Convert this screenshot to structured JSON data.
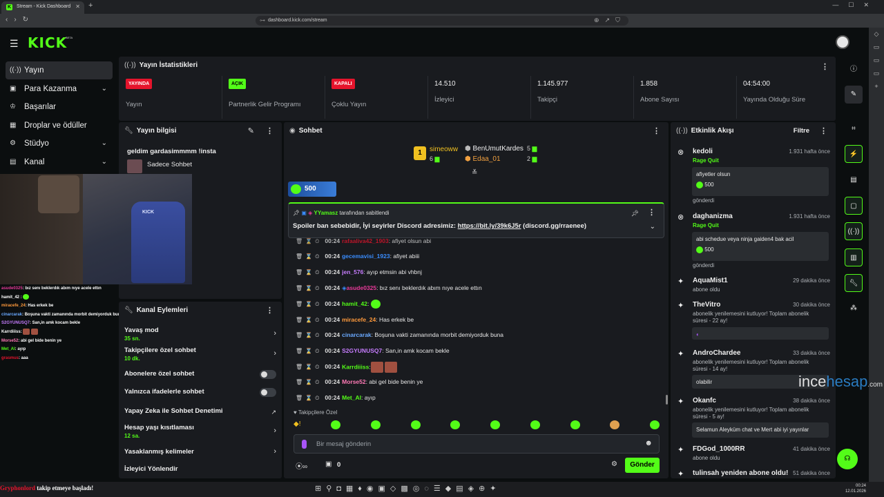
{
  "browser": {
    "tab_title": "Stream - Kick Dashboard",
    "url": "dashboard.kick.com/stream"
  },
  "brand": {
    "logo": "KICK",
    "beta": "BETA",
    "accent": "#53fc18"
  },
  "nav": [
    {
      "label": "Yayın",
      "icon": "broadcast-icon"
    },
    {
      "label": "Para Kazanma",
      "icon": "money-icon"
    },
    {
      "label": "Başarılar",
      "icon": "trophy-icon"
    },
    {
      "label": "Droplar ve ödüller",
      "icon": "gift-icon"
    },
    {
      "label": "Stüdyo",
      "icon": "studio-icon"
    },
    {
      "label": "Kanal",
      "icon": "channel-icon"
    }
  ],
  "stats": {
    "title": "Yayın İstatistikleri",
    "items": [
      {
        "badge": "YAYINDA",
        "label": "Yayın",
        "color": "#e5142c"
      },
      {
        "badge": "AÇIK",
        "label": "Partnerlik Gelir Programı",
        "color": "#53fc18"
      },
      {
        "badge": "KAPALI",
        "label": "Çoklu Yayın",
        "color": "#e5142c"
      },
      {
        "value": "14.510",
        "label": "İzleyici"
      },
      {
        "value": "1.145.977",
        "label": "Takipçi"
      },
      {
        "value": "1.858",
        "label": "Abone Sayısı"
      },
      {
        "value": "04:54:00",
        "label": "Yayında Olduğu Süre"
      }
    ]
  },
  "info": {
    "title": "Yayın bilgisi",
    "stream_title": "geldim gardasimmmm !insta",
    "category": "Sadece Sohbet"
  },
  "overlay_chat": [
    {
      "user": "asude0325",
      "msg": ": bız senı beklerdık abım nıye acele ettın",
      "color": "#e83a9a"
    },
    {
      "user": "hamit_42",
      "msg": " :",
      "color": "#f0f0f0"
    },
    {
      "user": "miracefe_24",
      "msg": ": Has erkek be",
      "color": "#ff9a3c"
    },
    {
      "user": "cinarcarak",
      "msg": ": Boşuna vakti zamanında morbit demiyorduk buna",
      "color": "#6aa9ff"
    },
    {
      "user": "S2GYUNUSQ7",
      "msg": ": San,in amk kocam bekle",
      "color": "#c77dff"
    },
    {
      "user": "Karrdiiiss",
      "msg": ":",
      "color": "#53fc18"
    },
    {
      "user": "Morse52",
      "msg": ": abi gel bide benin ye",
      "color": "#ff7ab6"
    },
    {
      "user": "Met_Al",
      "msg": ": ayıp",
      "color": "#53fc18"
    },
    {
      "user": "grasmus",
      "msg": ": aaa",
      "color": "#e5142c"
    }
  ],
  "actions": {
    "title": "Kanal Eylemleri",
    "items": [
      {
        "label": "Yavaş mod",
        "sub": "35 sn.",
        "type": "chev"
      },
      {
        "label": "Takipçilere özel sohbet",
        "sub": "10 dk.",
        "type": "chev"
      },
      {
        "label": "Abonelere özel sohbet",
        "type": "toggle"
      },
      {
        "label": "Yalnızca ifadelerle sohbet",
        "type": "toggle"
      },
      {
        "label": "Yapay Zeka ile Sohbet Denetimi",
        "type": "ext"
      },
      {
        "label": "Hesap yaşı kısıtlaması",
        "sub": "12 sa.",
        "type": "chev"
      },
      {
        "label": "Yasaklanmış kelimeler",
        "type": "chev"
      },
      {
        "label": "İzleyici Yönlendir",
        "type": "none"
      }
    ]
  },
  "chat": {
    "title": "Sohbet",
    "top1": {
      "name": "simeoww",
      "count": "6",
      "rank": "1"
    },
    "top2": {
      "name": "BenUmutKardes",
      "count": "5"
    },
    "top3": {
      "name": "Edaa_01",
      "count": "2"
    },
    "goal": "500",
    "pinned_by": "YYamasz",
    "pinned_suffix": "tarafından sabitlendi",
    "pinned_text": "Spoiler ban sebebidir, İyi seyirler Discord adresimiz:",
    "pinned_link": "https://bit.ly/39k6J5r",
    "pinned_tail": "(discord.gg/rraenee)",
    "messages": [
      {
        "time": "00:24",
        "user": "rafaaliva42_1903",
        "msg": ": afiyet olsun abi",
        "color": "#e5142c"
      },
      {
        "time": "00:24",
        "user": "gecemavisi_1923",
        "msg": ": afiyet abiii",
        "color": "#3a8dff"
      },
      {
        "time": "00:24",
        "user": "jen_576",
        "msg": ": ayıp etmsin abi vhbnj",
        "color": "#c77dff"
      },
      {
        "time": "00:24",
        "user": "asude0325",
        "msg": ": bız senı beklerdık abım nıye acele ettın",
        "color": "#e83a9a"
      },
      {
        "time": "00:24",
        "user": "hamit_42",
        "msg": ":",
        "color": "#53fc18"
      },
      {
        "time": "00:24",
        "user": "miracefe_24",
        "msg": ": Has erkek be",
        "color": "#ff9a3c"
      },
      {
        "time": "00:24",
        "user": "cinarcarak",
        "msg": ": Boşuna vakti zamanında morbit demiyorduk buna",
        "color": "#6aa9ff"
      },
      {
        "time": "00:24",
        "user": "S2GYUNUSQ7",
        "msg": ": San,in amk kocam bekle",
        "color": "#c77dff"
      },
      {
        "time": "00:24",
        "user": "Karrdiiiss",
        "msg": ":",
        "color": "#53fc18"
      },
      {
        "time": "00:24",
        "user": "Morse52",
        "msg": ": abi gel bide benin ye",
        "color": "#ff7ab6"
      },
      {
        "time": "00:24",
        "user": "Met_Al",
        "msg": ": ayıp",
        "color": "#53fc18"
      }
    ],
    "follower_only": "Takipçilere Özel",
    "placeholder": "Bir mesaj gönderin",
    "send": "Gönder",
    "points": "0"
  },
  "activity": {
    "title": "Etkinlik Akışı",
    "filter": "Filtre",
    "events": [
      {
        "name": "kedoli",
        "time": "1.931 hafta önce",
        "sub": "Rage Quit",
        "box": "afiyetler olsun",
        "amount": "500",
        "footer": "gönderdi"
      },
      {
        "name": "daghanizma",
        "time": "1.931 hafta önce",
        "sub": "Rage Quit",
        "box": "abi schedue veya ninja gaiden4 bak acil",
        "amount": "500",
        "footer": "gönderdi"
      },
      {
        "name": "AquaMist1",
        "time": "29 dakika önce",
        "sub": "abone oldu"
      },
      {
        "name": "TheVitro",
        "time": "30 dakika önce",
        "sub": "abonelik yenilemesini kutluyor! Toplam abonelik",
        "sub2": "süresi - 22 ay!"
      },
      {
        "name": "AndroChardee",
        "time": "33 dakika önce",
        "sub": "abonelik yenilemesini kutluyor! Toplam abonelik",
        "sub2": "süresi - 14 ay!",
        "box": "olabilir"
      },
      {
        "name": "Okanfc",
        "time": "38 dakika önce",
        "sub": "abonelik yenilemesini kutluyor! Toplam abonelik",
        "sub2": "süresi - 5 ay!",
        "box": "Selamun Aleyküm chat ve Mert abi iyi yayınlar"
      },
      {
        "name": "FDGod_1000RR",
        "time": "41 dakika önce",
        "sub": "abone oldu"
      },
      {
        "name": "tulinsah yeniden abone oldu!",
        "time": "51 dakika önce"
      }
    ]
  },
  "taskbar": {
    "time": "00:24",
    "date": "12.01.2026",
    "notif_user": "Gryphonlord",
    "notif": "takip etmeye başladı!"
  },
  "watermark": {
    "a": "ince",
    "b": "hesap",
    ".com": ".com"
  }
}
